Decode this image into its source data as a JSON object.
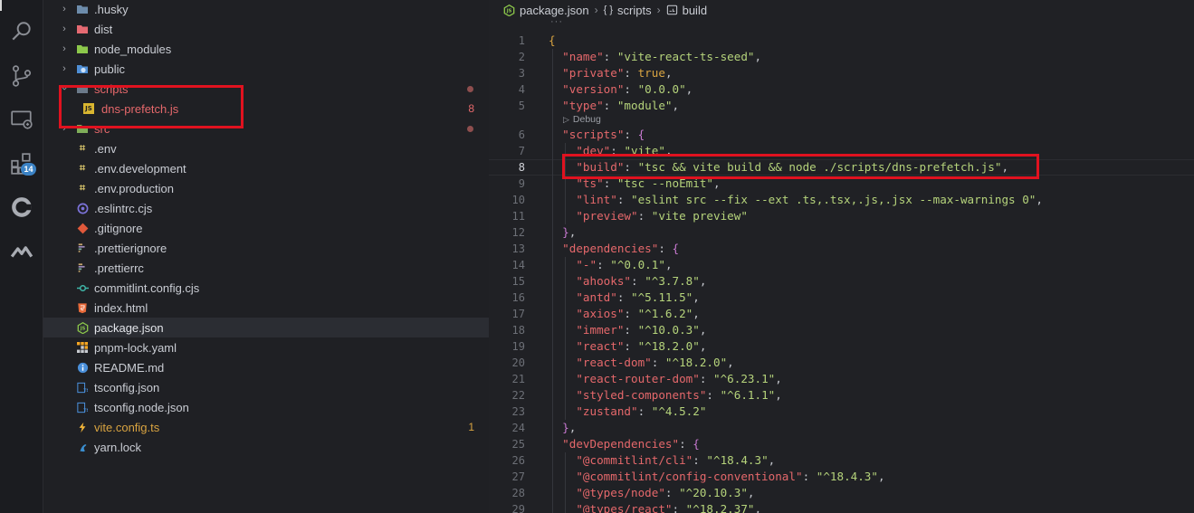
{
  "activity_bar": {
    "items": [
      {
        "icon": "search-icon"
      },
      {
        "icon": "source-control-icon"
      },
      {
        "icon": "remote-explorer-icon"
      },
      {
        "icon": "extensions-icon",
        "badge": "14"
      },
      {
        "icon": "copilot-icon"
      },
      {
        "icon": "tabnine-icon"
      }
    ]
  },
  "explorer": {
    "rows": [
      {
        "label": ".husky",
        "type": "folder",
        "icon": "folder-husky-icon"
      },
      {
        "label": "dist",
        "type": "folder",
        "icon": "folder-dist-icon"
      },
      {
        "label": "node_modules",
        "type": "folder",
        "icon": "folder-node-icon"
      },
      {
        "label": "public",
        "type": "folder",
        "icon": "folder-public-icon"
      },
      {
        "label": "scripts",
        "type": "folder-open",
        "icon": "folder-scripts-icon"
      },
      {
        "label": "dns-prefetch.js",
        "type": "file",
        "icon": "js-file-icon",
        "status": "8"
      },
      {
        "label": "src",
        "type": "folder",
        "icon": "folder-src-icon"
      },
      {
        "label": ".env",
        "type": "file",
        "icon": "env-file-icon"
      },
      {
        "label": ".env.development",
        "type": "file",
        "icon": "env-file-icon"
      },
      {
        "label": ".env.production",
        "type": "file",
        "icon": "env-file-icon"
      },
      {
        "label": ".eslintrc.cjs",
        "type": "file",
        "icon": "eslint-file-icon"
      },
      {
        "label": ".gitignore",
        "type": "file",
        "icon": "git-file-icon"
      },
      {
        "label": ".prettierignore",
        "type": "file",
        "icon": "prettier-file-icon"
      },
      {
        "label": ".prettierrc",
        "type": "file",
        "icon": "prettier-file-icon"
      },
      {
        "label": "commitlint.config.cjs",
        "type": "file",
        "icon": "commitlint-file-icon"
      },
      {
        "label": "index.html",
        "type": "file",
        "icon": "html-file-icon"
      },
      {
        "label": "package.json",
        "type": "file",
        "icon": "node-json-file-icon"
      },
      {
        "label": "pnpm-lock.yaml",
        "type": "file",
        "icon": "pnpm-file-icon"
      },
      {
        "label": "README.md",
        "type": "file",
        "icon": "info-file-icon"
      },
      {
        "label": "tsconfig.json",
        "type": "file",
        "icon": "ts-config-file-icon"
      },
      {
        "label": "tsconfig.node.json",
        "type": "file",
        "icon": "ts-config-file-icon"
      },
      {
        "label": "vite.config.ts",
        "type": "file",
        "icon": "vite-file-icon",
        "status": "1"
      },
      {
        "label": "yarn.lock",
        "type": "file",
        "icon": "yarn-file-icon"
      }
    ]
  },
  "editor": {
    "breadcrumbs": [
      "package.json",
      "scripts",
      "build"
    ],
    "codelens": "Debug",
    "lines": [
      {
        "n": "1"
      },
      {
        "n": "2"
      },
      {
        "n": "3"
      },
      {
        "n": "4"
      },
      {
        "n": "5"
      },
      {
        "n": "6"
      },
      {
        "n": "7"
      },
      {
        "n": "8"
      },
      {
        "n": "9"
      },
      {
        "n": "10"
      },
      {
        "n": "11"
      },
      {
        "n": "12"
      },
      {
        "n": "13"
      },
      {
        "n": "14"
      },
      {
        "n": "15"
      },
      {
        "n": "16"
      },
      {
        "n": "17"
      },
      {
        "n": "18"
      },
      {
        "n": "19"
      },
      {
        "n": "20"
      },
      {
        "n": "21"
      },
      {
        "n": "22"
      },
      {
        "n": "23"
      },
      {
        "n": "24"
      },
      {
        "n": "25"
      },
      {
        "n": "26"
      },
      {
        "n": "27"
      },
      {
        "n": "28"
      },
      {
        "n": "29"
      }
    ],
    "code": {
      "l2k": "\"name\"",
      "l2v": "\"vite-react-ts-seed\"",
      "l3k": "\"private\"",
      "l3v": "true",
      "l4k": "\"version\"",
      "l4v": "\"0.0.0\"",
      "l5k": "\"type\"",
      "l5v": "\"module\"",
      "l6k": "\"scripts\"",
      "l7k": "\"dev\"",
      "l7v": "\"vite\"",
      "l8k": "\"build\"",
      "l8v": "\"tsc && vite build && node ./scripts/dns-prefetch.js\"",
      "l9k": "\"ts\"",
      "l9v": "\"tsc --noEmit\"",
      "l10k": "\"lint\"",
      "l10v": "\"eslint src --fix --ext .ts,.tsx,.js,.jsx --max-warnings 0\"",
      "l11k": "\"preview\"",
      "l11v": "\"vite preview\"",
      "l13k": "\"dependencies\"",
      "l14k": "\"-\"",
      "l14v": "\"^0.0.1\"",
      "l15k": "\"ahooks\"",
      "l15v": "\"^3.7.8\"",
      "l16k": "\"antd\"",
      "l16v": "\"^5.11.5\"",
      "l17k": "\"axios\"",
      "l17v": "\"^1.6.2\"",
      "l18k": "\"immer\"",
      "l18v": "\"^10.0.3\"",
      "l19k": "\"react\"",
      "l19v": "\"^18.2.0\"",
      "l20k": "\"react-dom\"",
      "l20v": "\"^18.2.0\"",
      "l21k": "\"react-router-dom\"",
      "l21v": "\"^6.23.1\"",
      "l22k": "\"styled-components\"",
      "l22v": "\"^6.1.1\"",
      "l23k": "\"zustand\"",
      "l23v": "\"^4.5.2\"",
      "l25k": "\"devDependencies\"",
      "l26k": "\"@commitlint/cli\"",
      "l26v": "\"^18.4.3\"",
      "l27k": "\"@commitlint/config-conventional\"",
      "l27v": "\"^18.4.3\"",
      "l28k": "\"@types/node\"",
      "l28v": "\"^20.10.3\"",
      "l29k": "\"@types/react\"",
      "l29v": "\"^18.2.37\""
    }
  },
  "colors": {
    "key": "#e5686b",
    "string": "#b5d37b",
    "modified": "#e5686b",
    "warning": "#d9a441",
    "highlight_box": "#e0121f"
  }
}
